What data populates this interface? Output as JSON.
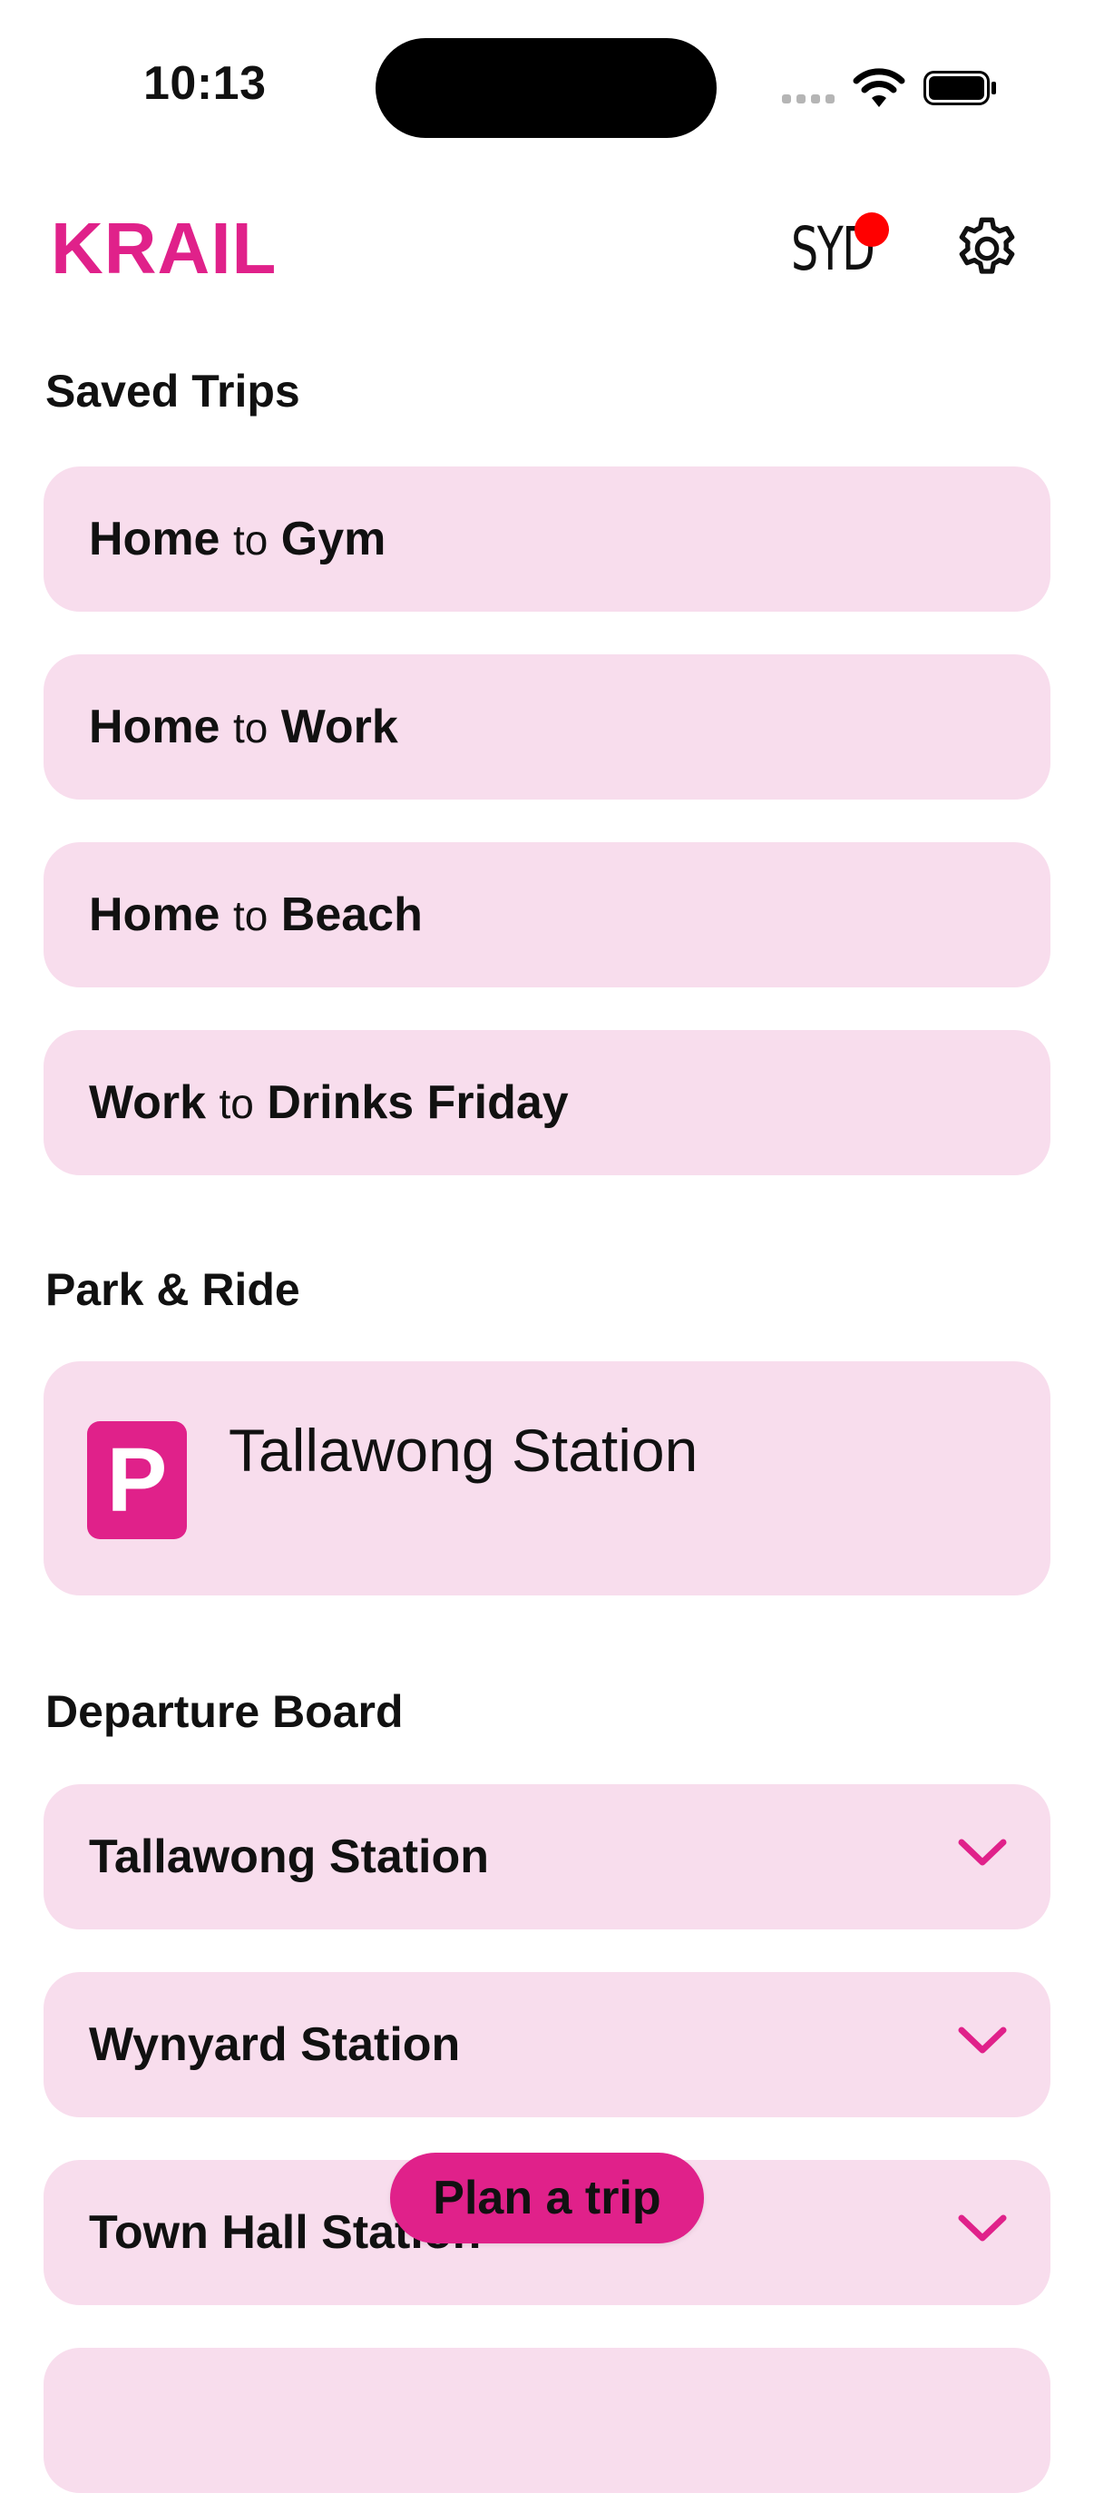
{
  "status_bar": {
    "time": "10:13"
  },
  "header": {
    "logo": "KRAIL",
    "city_code": "SYD"
  },
  "saved_trips": {
    "title": "Saved Trips",
    "items": [
      {
        "from": "Home",
        "connector": "to",
        "to": "Gym"
      },
      {
        "from": "Home",
        "connector": "to",
        "to": "Work"
      },
      {
        "from": "Home",
        "connector": "to",
        "to": "Beach"
      },
      {
        "from": "Work",
        "connector": "to",
        "to": "Drinks Friday"
      }
    ]
  },
  "park_ride": {
    "title": "Park & Ride",
    "icon_letter": "P",
    "station": "Tallawong Station"
  },
  "departure_board": {
    "title": "Departure Board",
    "stations": [
      "Tallawong Station",
      "Wynyard Station",
      "Town Hall Station"
    ]
  },
  "fab": {
    "label": "Plan a trip"
  },
  "colors": {
    "accent": "#e0218a",
    "card_bg": "#f8dded",
    "notification": "#ff0000"
  },
  "icons": [
    "wifi-icon",
    "battery-icon",
    "gear-icon",
    "chevron-down-icon",
    "parking-icon"
  ]
}
